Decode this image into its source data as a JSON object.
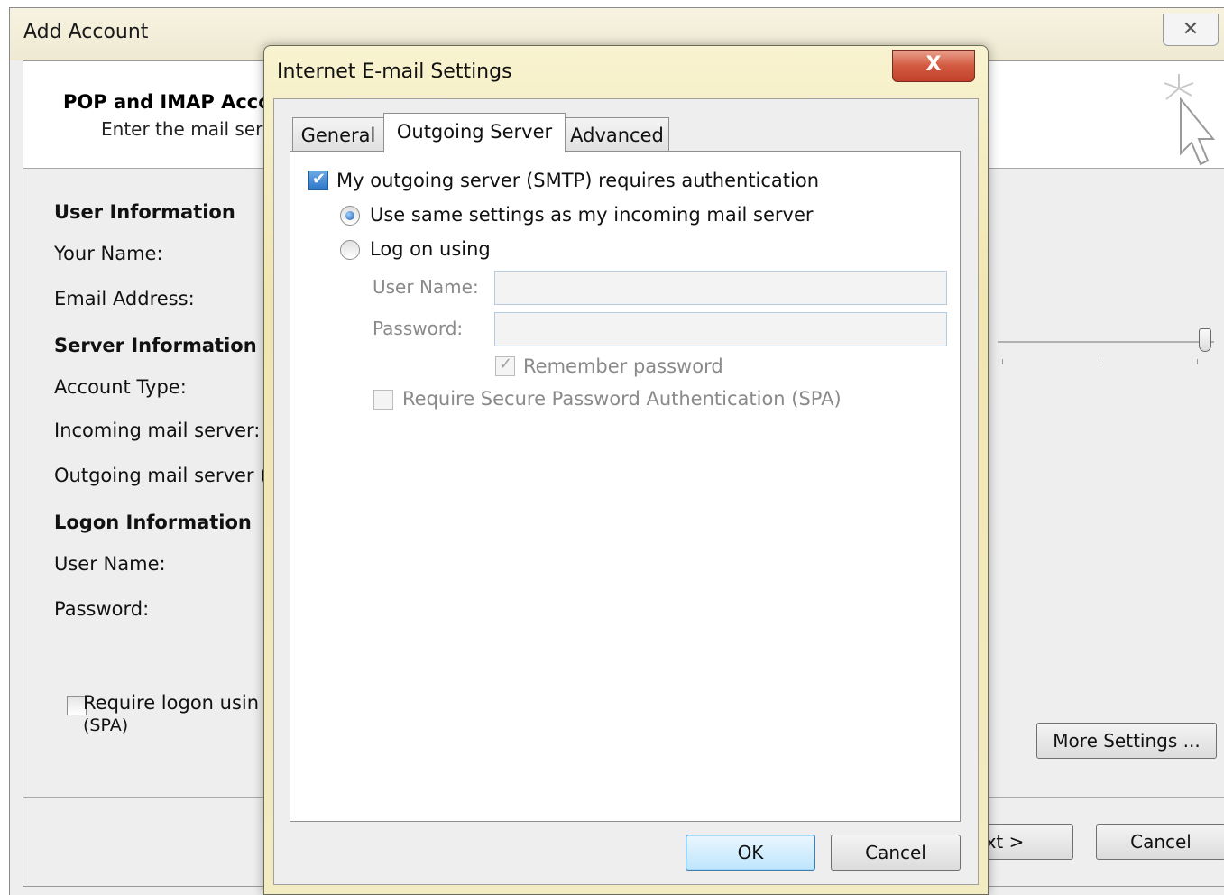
{
  "background_window": {
    "title": "Add Account",
    "close_glyph": "✕",
    "header": {
      "heading": "POP and IMAP Accou",
      "subheading": "Enter the mail serv"
    },
    "sections": {
      "user_information": "User Information",
      "your_name": "Your Name:",
      "email_address": "Email Address:",
      "server_information": "Server Information",
      "account_type": "Account Type:",
      "incoming_server": "Incoming mail server:",
      "outgoing_server": "Outgoing mail server (",
      "logon_information": "Logon Information",
      "user_name": "User Name:",
      "password": "Password:"
    },
    "require_logon": {
      "line1": "Require logon usin",
      "line2": "(SPA)",
      "checked": false
    },
    "buttons": {
      "more_settings": "More Settings ...",
      "next": "ext >",
      "cancel": "Cancel"
    }
  },
  "dialog": {
    "title": "Internet E-mail Settings",
    "close_glyph": "X",
    "tabs": [
      {
        "label": "General",
        "active": false
      },
      {
        "label": "Outgoing Server",
        "active": true
      },
      {
        "label": "Advanced",
        "active": false
      }
    ],
    "outgoing": {
      "requires_auth_label": "My outgoing server (SMTP) requires authentication",
      "requires_auth_checked": true,
      "same_settings_label": "Use same settings as my incoming mail server",
      "same_settings_selected": true,
      "log_on_using_label": "Log on using",
      "user_name_label": "User Name:",
      "user_name_value": "",
      "password_label": "Password:",
      "password_value": "",
      "remember_password_label": "Remember password",
      "remember_password_checked": true,
      "spa_label": "Require Secure Password Authentication (SPA)",
      "spa_checked": false
    },
    "buttons": {
      "ok": "OK",
      "cancel": "Cancel"
    }
  },
  "colors": {
    "dialog_frame": "#f1e6b0",
    "close_button": "#c2412a",
    "check_blue": "#2d76c8"
  }
}
